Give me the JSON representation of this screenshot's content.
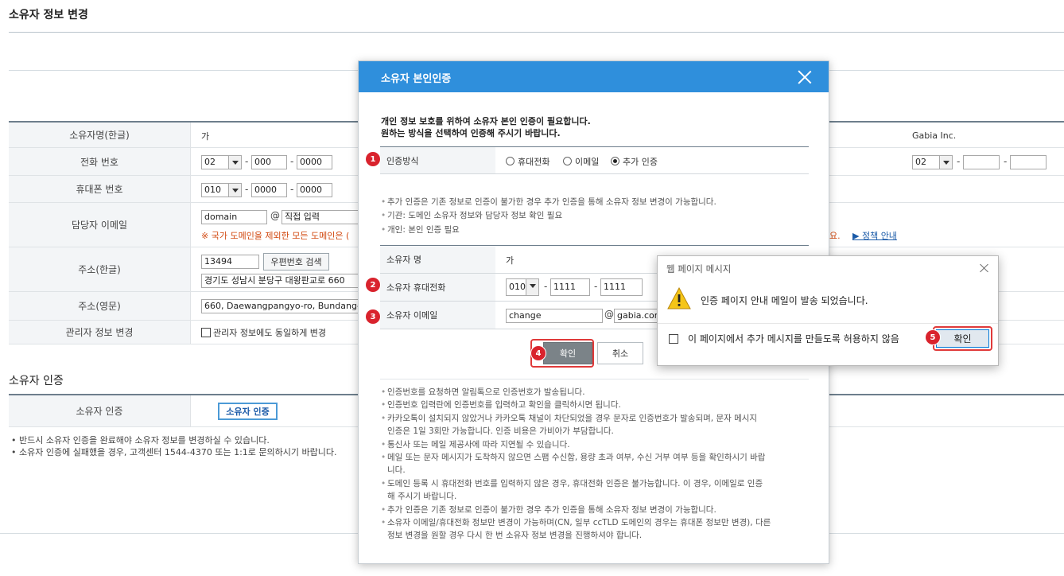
{
  "page": {
    "title": "소유자 정보 변경",
    "rows": {
      "name_ko": {
        "label": "소유자명(한글)",
        "value": "가"
      },
      "phone": {
        "label": "전화 번호",
        "area": "02",
        "mid": "000",
        "last": "0000"
      },
      "mobile": {
        "label": "휴대폰 번호",
        "prefix": "010",
        "mid": "0000",
        "last": "0000"
      },
      "email": {
        "label": "담당자 이메일",
        "local": "domain",
        "at": "@",
        "domain_select": "직접 입력",
        "warning": "※ 국가 도메인을 제외한 모든 도메인은 (",
        "warning_tail": "요.",
        "policy_link": "▶ 정책 안내"
      },
      "address_ko": {
        "label": "주소(한글)",
        "zipcode": "13494",
        "zip_button": "우편번호 검색",
        "address": "경기도 성남시 분당구 대왕판교로 660"
      },
      "address_en": {
        "label": "주소(영문)",
        "address": "660, Daewangpangyo-ro, Bundang-gu, S"
      },
      "admin_change": {
        "label": "관리자 정보 변경",
        "checkbox_label": "관리자 정보에도 동일하게 변경"
      }
    },
    "right_column": {
      "company": "Gabia Inc.",
      "phone_area": "02"
    },
    "owner_auth": {
      "section_title": "소유자 인증",
      "row_label": "소유자 인증",
      "button": "소유자 인증",
      "notes": [
        "반드시 소유자 인증을 완료해야 소유자 정보를 변경하실 수 있습니다.",
        "소유자 인증에 실패했을 경우, 고객센터 1544-4370 또는 1:1로 문의하시기 바랍니다."
      ]
    }
  },
  "modal": {
    "title": "소유자 본인인증",
    "intro": [
      "개인 정보 보호를 위하여 소유자 본인 인증이 필요합니다.",
      "원하는 방식을 선택하여 인증해 주시기 바랍니다."
    ],
    "method": {
      "label": "인증방식",
      "options": [
        "휴대전화",
        "이메일",
        "추가 인증"
      ],
      "selected": "추가 인증"
    },
    "info": [
      "추가 인증은 기존 정보로 인증이 불가한 경우 추가 인증을 통해 소유자 정보 변경이 가능합니다.",
      "기관: 도메인 소유자 정보와 담당자 정보 확인 필요",
      "개인: 본인 인증 필요"
    ],
    "fields": {
      "name": {
        "label": "소유자 명",
        "value": "가"
      },
      "mobile": {
        "label": "소유자 휴대전화",
        "prefix": "010",
        "mid": "1111",
        "last": "1111"
      },
      "email": {
        "label": "소유자 이메일",
        "local": "change",
        "at": "@",
        "domain": "gabia.com"
      }
    },
    "confirm": "확인",
    "cancel": "취소",
    "notes": [
      "인증번호를 요청하면 알림톡으로 인증번호가 발송됩니다.",
      "인증번호 입력란에 인증번호를 입력하고 확인을 클릭하시면 됩니다.",
      "카카오톡이 설치되지 않았거나 카카오톡 채널이 차단되었을 경우 문자로 인증번호가 발송되며, 문자 메시지",
      "인증은 1일 3회만 가능합니다. 인증 비용은 가비아가 부담합니다.",
      "통신사 또는 메일 제공사에 따라 지연될 수 있습니다.",
      "메일 또는 문자 메시지가 도착하지 않으면 스팸 수신함, 용량 초과 여부, 수신 거부 여부 등을 확인하시기 바랍",
      "니다.",
      "도메인 등록 시 휴대전화 번호를 입력하지 않은 경우, 휴대전화 인증은 불가능합니다. 이 경우, 이메일로 인증",
      "해 주시기 바랍니다.",
      "추가 인증은 기존 정보로 인증이 불가한 경우 추가 인증을 통해 소유자 정보 변경이 가능합니다.",
      "소유자 이메일/휴대전화 정보만 변경이 가능하며(CN, 일부 ccTLD 도메인의 경우는 휴대폰 정보만 변경), 다른",
      "정보 변경을 원할 경우 다시 한 번 소유자 정보 변경을 진행하셔야 합니다."
    ]
  },
  "dialog": {
    "title": "웹 페이지 메시지",
    "message": "인증 페이지 안내 메일이 발송 되었습니다.",
    "checkbox_label": "이 페이지에서 추가 메시지를 만들도록 허용하지 않음",
    "ok": "확인"
  },
  "badges": [
    "1",
    "2",
    "3",
    "4",
    "5"
  ],
  "colors": {
    "modal_header": "#2f8fdc",
    "badge": "#d9232d",
    "highlight": "#e03a3a"
  }
}
